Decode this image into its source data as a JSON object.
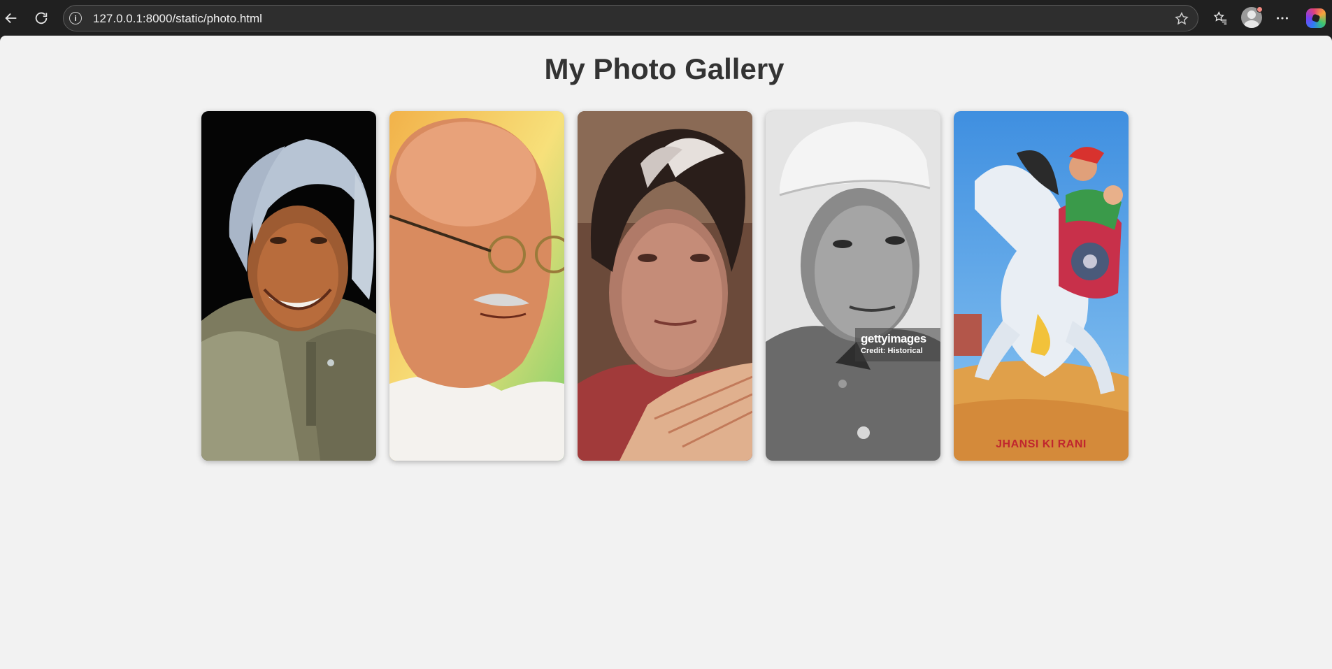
{
  "browser": {
    "url": "127.0.0.1:8000/static/photo.html"
  },
  "page": {
    "title": "My Photo Gallery"
  },
  "gallery": {
    "photos": [
      {
        "subject": "portrait-elderly-man-silver-hair"
      },
      {
        "subject": "portrait-man-round-glasses"
      },
      {
        "subject": "portrait-woman-grey-hair-saree"
      },
      {
        "subject": "portrait-man-white-cap-bw",
        "watermark": "gettyimages",
        "watermark_credit": "Credit: Historical"
      },
      {
        "subject": "painting-rider-on-white-horse",
        "caption": "JHANSI KI RANI"
      }
    ]
  },
  "colors": {
    "page_bg": "#f2f2f2",
    "chrome_bg": "#202020",
    "title_text": "#333333",
    "caption_red": "#c0262e"
  }
}
